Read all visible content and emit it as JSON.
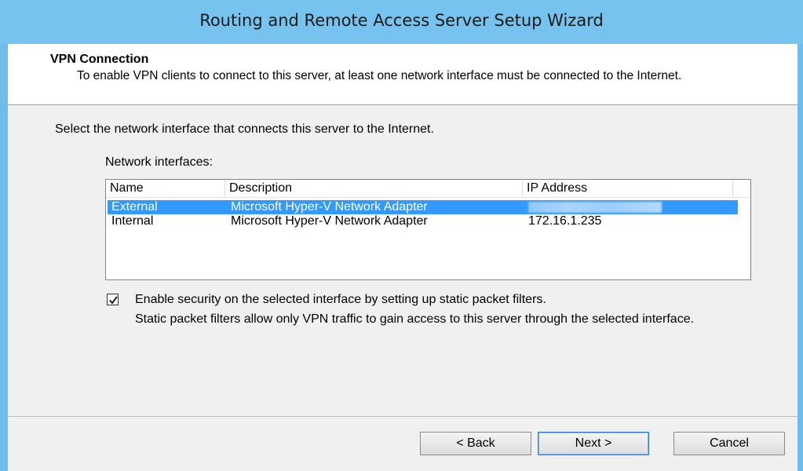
{
  "window": {
    "title": "Routing and Remote Access Server Setup Wizard"
  },
  "header": {
    "title": "VPN Connection",
    "description": "To enable VPN clients to connect to this server, at least one network interface must be connected to the Internet."
  },
  "instruction": "Select the network interface that connects this server to the Internet.",
  "interfaces": {
    "label": "Network interfaces:",
    "columns": [
      "Name",
      "Description",
      "IP Address"
    ],
    "rows": [
      {
        "name": "External",
        "description": "Microsoft Hyper-V Network Adapter",
        "ip": "",
        "selected": true
      },
      {
        "name": "Internal",
        "description": "Microsoft Hyper-V Network Adapter",
        "ip": "172.16.1.235",
        "selected": false
      }
    ]
  },
  "security": {
    "checked": true,
    "label": "Enable security on the selected interface by setting up static packet filters.",
    "description": "Static packet filters allow only VPN traffic to gain access to this server through the selected interface."
  },
  "buttons": {
    "back": "< Back",
    "next": "Next >",
    "cancel": "Cancel"
  },
  "colors": {
    "titlebar": "#75c3ee",
    "selection": "#3399ff"
  }
}
